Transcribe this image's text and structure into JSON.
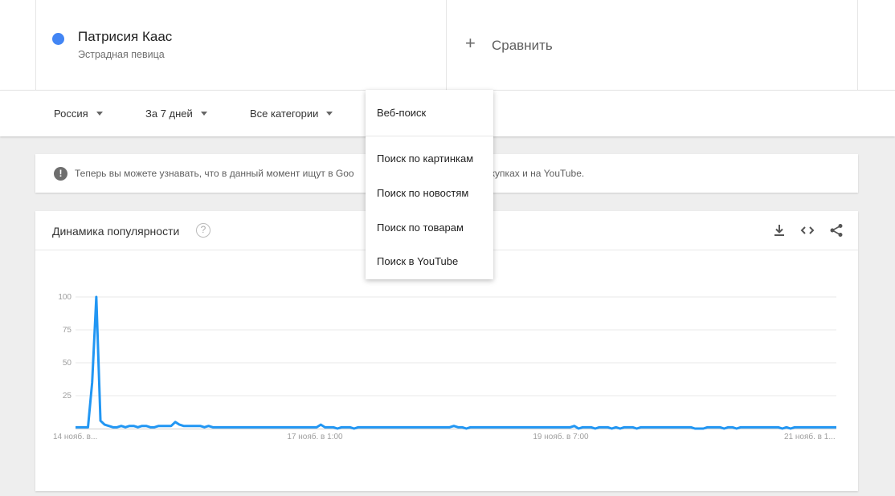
{
  "term": {
    "name": "Патрисия Каас",
    "subtitle": "Эстрадная певица",
    "color": "#4285f4"
  },
  "compare": {
    "icon": "plus-icon",
    "label": "Сравнить"
  },
  "filters": {
    "region": "Россия",
    "period": "За 7 дней",
    "category": "Все категории"
  },
  "search_type_menu": {
    "selected": "Веб-поиск",
    "options": [
      "Поиск по картинкам",
      "Поиск по новостям",
      "Поиск по товарам",
      "Поиск в YouTube"
    ]
  },
  "notice": {
    "icon": "exclamation-icon",
    "text_left": "Теперь вы можете узнавать, что в данный момент ищут в Goo",
    "text_right": "окупках и на YouTube."
  },
  "chart_panel": {
    "title": "Динамика популярности",
    "help_icon": "question-icon",
    "actions": [
      "download-icon",
      "embed-code-icon",
      "share-icon"
    ]
  },
  "chart_data": {
    "type": "line",
    "ylim": [
      0,
      100
    ],
    "y_ticks": [
      25,
      50,
      75,
      100
    ],
    "x_tick_labels": [
      "14 нояб. в...",
      "17 нояб. в 1:00",
      "19 нояб. в 7:00",
      "21 нояб. в 1..."
    ],
    "grid": true,
    "series": [
      {
        "color": "#2196f3",
        "values": [
          1,
          1,
          1,
          1,
          35,
          100,
          6,
          3,
          2,
          1,
          1,
          2,
          1,
          2,
          2,
          1,
          2,
          2,
          1,
          1,
          2,
          2,
          2,
          2,
          5,
          3,
          2,
          2,
          2,
          2,
          2,
          1,
          2,
          1,
          1,
          1,
          1,
          1,
          1,
          1,
          1,
          1,
          1,
          1,
          1,
          1,
          1,
          1,
          1,
          1,
          1,
          1,
          1,
          1,
          1,
          1,
          1,
          1,
          1,
          3,
          1,
          1,
          1,
          0,
          1,
          1,
          1,
          0,
          1,
          1,
          1,
          1,
          1,
          1,
          1,
          1,
          1,
          1,
          1,
          1,
          1,
          1,
          1,
          1,
          1,
          1,
          1,
          1,
          1,
          1,
          1,
          2,
          1,
          1,
          0,
          1,
          1,
          1,
          1,
          1,
          1,
          1,
          1,
          1,
          1,
          1,
          1,
          1,
          1,
          1,
          1,
          1,
          1,
          1,
          1,
          1,
          1,
          1,
          1,
          1,
          2,
          0,
          1,
          1,
          1,
          0,
          1,
          1,
          1,
          0,
          1,
          0,
          1,
          1,
          1,
          0,
          1,
          1,
          1,
          1,
          1,
          1,
          1,
          1,
          1,
          1,
          1,
          1,
          1,
          0,
          0,
          0,
          1,
          1,
          1,
          1,
          0,
          1,
          1,
          0,
          1,
          1,
          1,
          1,
          1,
          1,
          1,
          1,
          1,
          1,
          0,
          1,
          0,
          1,
          1,
          1,
          1,
          1,
          1,
          1,
          1,
          1,
          1,
          1
        ]
      }
    ]
  }
}
